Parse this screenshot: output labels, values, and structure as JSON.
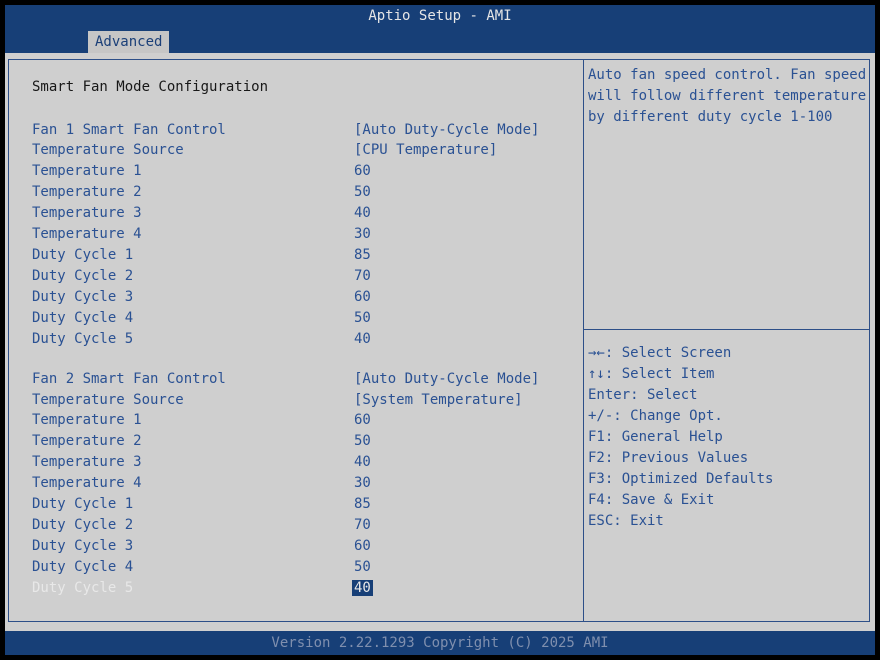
{
  "window": {
    "title": "Aptio Setup - AMI",
    "tab": "Advanced"
  },
  "main": {
    "section_title": "Smart Fan Mode Configuration",
    "fan1": {
      "control_label": "Fan 1 Smart Fan Control",
      "control_value": "[Auto Duty-Cycle Mode]",
      "source_label": "Temperature Source",
      "source_value": "[CPU Temperature]",
      "rows": [
        {
          "label": "Temperature 1",
          "value": "60"
        },
        {
          "label": "Temperature 2",
          "value": "50"
        },
        {
          "label": "Temperature 3",
          "value": "40"
        },
        {
          "label": "Temperature 4",
          "value": "30"
        },
        {
          "label": "Duty Cycle 1",
          "value": "85"
        },
        {
          "label": "Duty Cycle 2",
          "value": "70"
        },
        {
          "label": "Duty Cycle 3",
          "value": "60"
        },
        {
          "label": "Duty Cycle 4",
          "value": "50"
        },
        {
          "label": "Duty Cycle 5",
          "value": "40"
        }
      ]
    },
    "fan2": {
      "control_label": "Fan 2 Smart Fan Control",
      "control_value": "[Auto Duty-Cycle Mode]",
      "source_label": "Temperature Source",
      "source_value": "[System Temperature]",
      "rows": [
        {
          "label": "Temperature 1",
          "value": "60"
        },
        {
          "label": "Temperature 2",
          "value": "50"
        },
        {
          "label": "Temperature 3",
          "value": "40"
        },
        {
          "label": "Temperature 4",
          "value": "30"
        },
        {
          "label": "Duty Cycle 1",
          "value": "85"
        },
        {
          "label": "Duty Cycle 2",
          "value": "70"
        },
        {
          "label": "Duty Cycle 3",
          "value": "60"
        },
        {
          "label": "Duty Cycle 4",
          "value": "50"
        },
        {
          "label": "Duty Cycle 5",
          "value": "40"
        }
      ]
    }
  },
  "help": {
    "text": "Auto fan speed control. Fan speed will follow different temperature by different duty cycle 1-100"
  },
  "keys": [
    "→←: Select Screen",
    "↑↓: Select Item",
    "Enter: Select",
    "+/-: Change Opt.",
    "F1: General Help",
    "F2: Previous Values",
    "F3: Optimized Defaults",
    "F4: Save & Exit",
    "ESC: Exit"
  ],
  "footer": "Version 2.22.1293 Copyright (C) 2025 AMI",
  "colors": {
    "bar": "#173f77",
    "panel": "#cfcfcf",
    "text": "#2a5193"
  }
}
